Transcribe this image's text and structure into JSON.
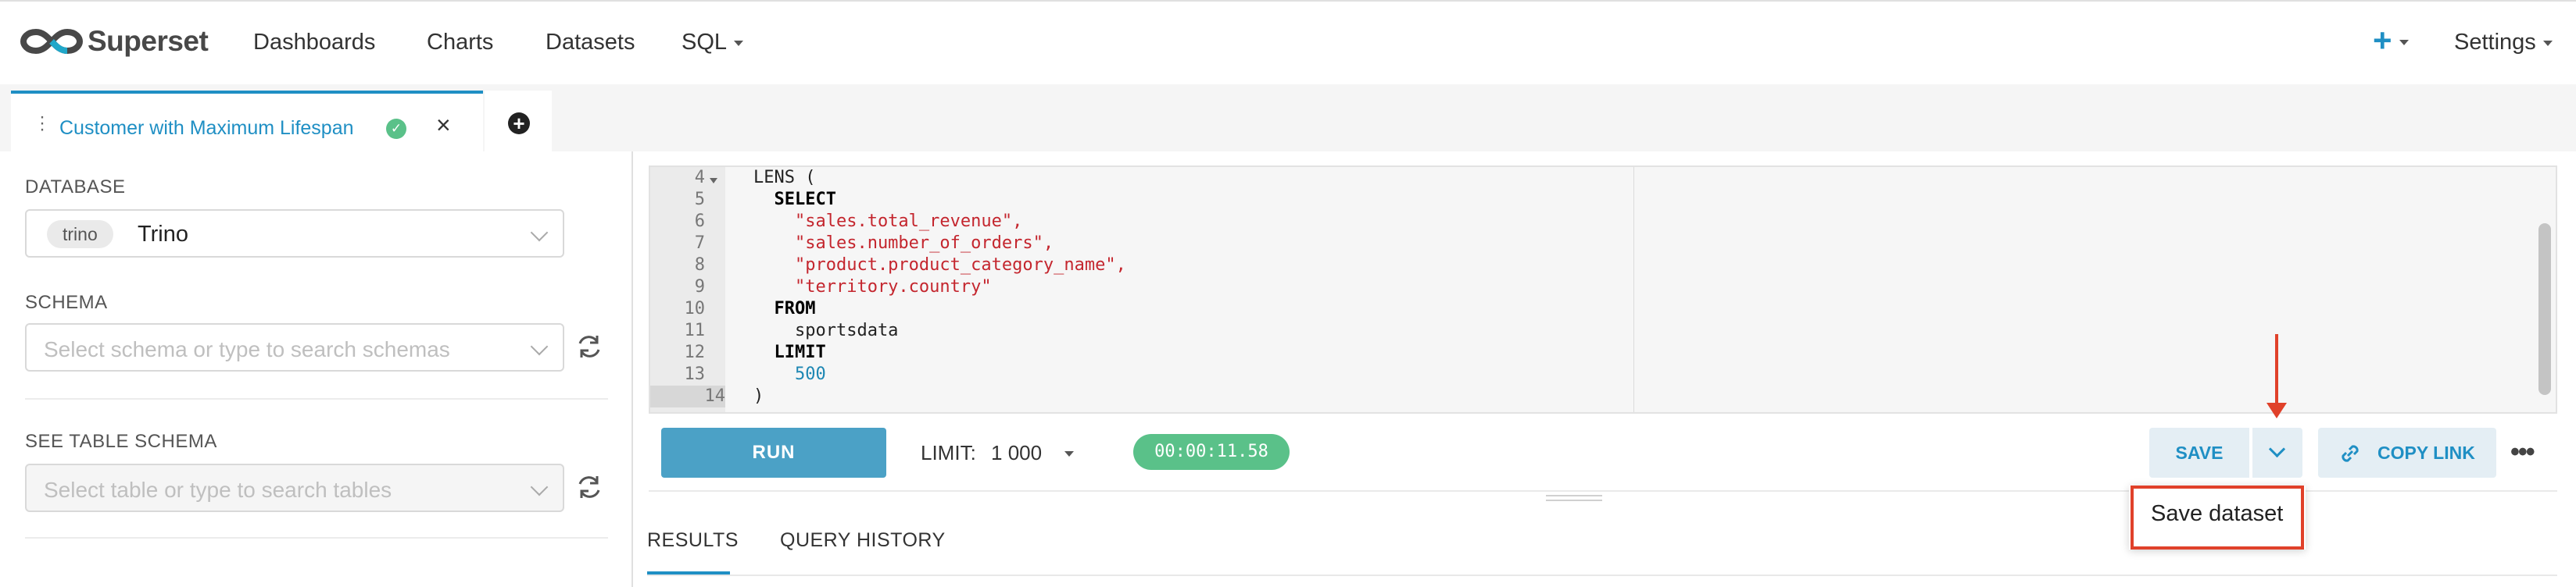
{
  "brand": {
    "name": "Superset"
  },
  "nav": {
    "items": [
      "Dashboards",
      "Charts",
      "Datasets",
      "SQL"
    ],
    "plus": "+",
    "settings": "Settings"
  },
  "tab": {
    "title": "Customer with Maximum Lifespan",
    "close": "×",
    "add": "+"
  },
  "left": {
    "database_label": "DATABASE",
    "database_chip": "trino",
    "database_name": "Trino",
    "schema_label": "SCHEMA",
    "schema_placeholder": "Select schema or type to search schemas",
    "table_label": "SEE TABLE SCHEMA",
    "table_placeholder": "Select table or type to search tables"
  },
  "editor": {
    "line_numbers": [
      "4",
      "5",
      "6",
      "7",
      "8",
      "9",
      "10",
      "11",
      "12",
      "13",
      "14"
    ],
    "lines": [
      "LENS (",
      "  SELECT",
      "    \"sales.total_revenue\",",
      "    \"sales.number_of_orders\",",
      "    \"product.product_category_name\",",
      "    \"territory.country\"",
      "  FROM",
      "    sportsdata",
      "  LIMIT",
      "    500",
      ")"
    ]
  },
  "toolbar": {
    "run_label": "RUN",
    "limit_label": "LIMIT:",
    "limit_value": "1 000",
    "timer": "00:00:11.58",
    "save_label": "SAVE",
    "copy_link_label": "COPY LINK",
    "more": "•••"
  },
  "results": {
    "tabs": [
      "RESULTS",
      "QUERY HISTORY"
    ]
  },
  "dropdown": {
    "save_dataset": "Save dataset"
  },
  "colors": {
    "accent": "#1f8fc4",
    "run_button": "#4ba1c6",
    "success": "#5ac189",
    "annotation": "#e0412a"
  }
}
